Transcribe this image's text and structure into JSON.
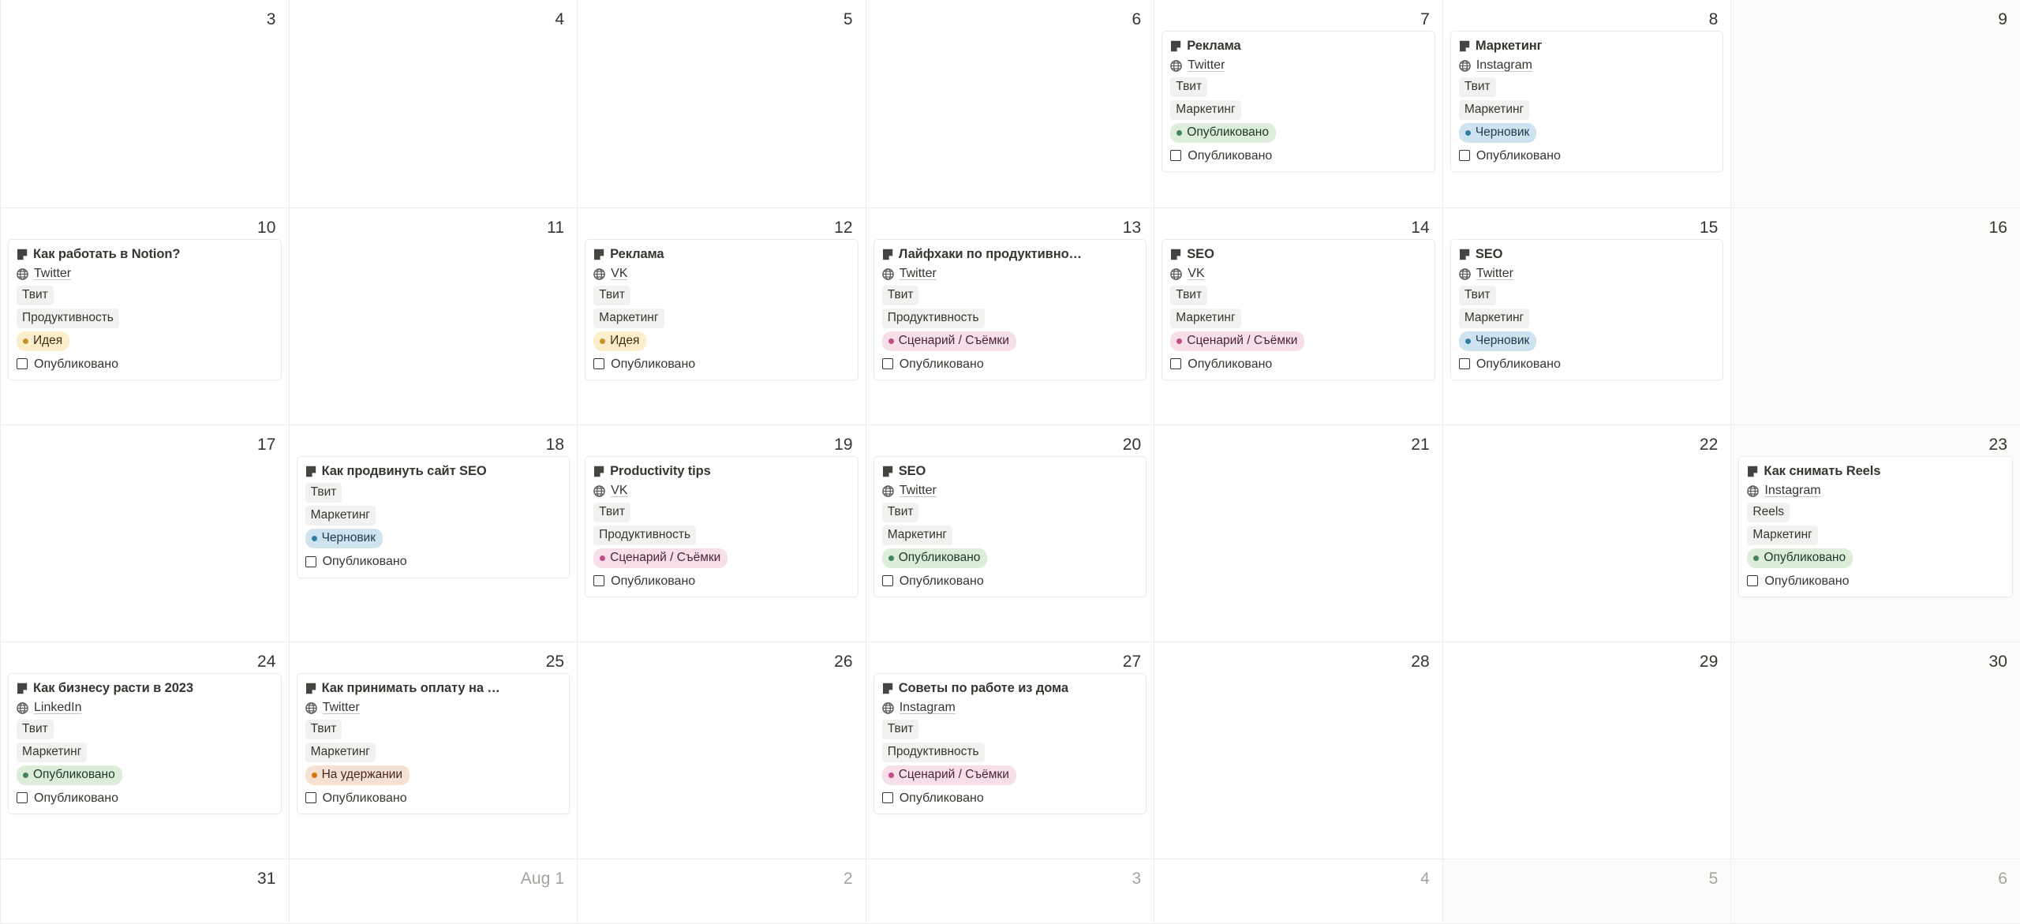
{
  "view": {
    "type": "calendar-month-grid",
    "columns": 7,
    "rows": 5
  },
  "status_styles": {
    "Опубликовано": {
      "bg": "#dcedda",
      "text": "#1c3829",
      "dot": "#448361"
    },
    "Черновик": {
      "bg": "#cfe3ef",
      "text": "#203b50",
      "dot": "#337ea9"
    },
    "Идея": {
      "bg": "#fbeeca",
      "text": "#402c1b",
      "dot": "#cb912f"
    },
    "Сценарий / Съёмки": {
      "bg": "#f7dfe9",
      "text": "#4c2337",
      "dot": "#c14c8a"
    },
    "На удержании": {
      "bg": "#f5e0d4",
      "text": "#49281e",
      "dot": "#d9730d"
    }
  },
  "cells": [
    {
      "date": "3",
      "other_month": false,
      "dim": false,
      "cards": []
    },
    {
      "date": "4",
      "other_month": false,
      "dim": false,
      "cards": []
    },
    {
      "date": "5",
      "other_month": false,
      "dim": false,
      "cards": []
    },
    {
      "date": "6",
      "other_month": false,
      "dim": false,
      "cards": []
    },
    {
      "date": "7",
      "other_month": false,
      "dim": false,
      "cards": [
        {
          "title": "Реклама",
          "url": "Twitter",
          "tags": [
            "Твит",
            "Маркетинг"
          ],
          "status": "Опубликовано",
          "check_label": "Опубликовано",
          "checked": false
        }
      ]
    },
    {
      "date": "8",
      "other_month": false,
      "dim": false,
      "cards": [
        {
          "title": "Маркетинг",
          "url": "Instagram",
          "tags": [
            "Твит",
            "Маркетинг"
          ],
          "status": "Черновик",
          "check_label": "Опубликовано",
          "checked": false
        }
      ]
    },
    {
      "date": "9",
      "other_month": false,
      "dim": true,
      "cards": []
    },
    {
      "date": "10",
      "other_month": false,
      "dim": false,
      "cards": [
        {
          "title": "Как работать в Notion?",
          "url": "Twitter",
          "tags": [
            "Твит",
            "Продуктивность"
          ],
          "status": "Идея",
          "check_label": "Опубликовано",
          "checked": false
        }
      ]
    },
    {
      "date": "11",
      "other_month": false,
      "dim": false,
      "cards": []
    },
    {
      "date": "12",
      "other_month": false,
      "dim": false,
      "cards": [
        {
          "title": "Реклама",
          "url": "VK",
          "tags": [
            "Твит",
            "Маркетинг"
          ],
          "status": "Идея",
          "check_label": "Опубликовано",
          "checked": false
        }
      ]
    },
    {
      "date": "13",
      "other_month": false,
      "dim": false,
      "cards": [
        {
          "title": "Лайфхаки по продуктивно…",
          "url": "Twitter",
          "tags": [
            "Твит",
            "Продуктивность"
          ],
          "status": "Сценарий / Съёмки",
          "check_label": "Опубликовано",
          "checked": false
        }
      ]
    },
    {
      "date": "14",
      "other_month": false,
      "dim": false,
      "cards": [
        {
          "title": "SEO",
          "url": "VK",
          "tags": [
            "Твит",
            "Маркетинг"
          ],
          "status": "Сценарий / Съёмки",
          "check_label": "Опубликовано",
          "checked": false
        }
      ]
    },
    {
      "date": "15",
      "other_month": false,
      "dim": false,
      "cards": [
        {
          "title": "SEO",
          "url": "Twitter",
          "tags": [
            "Твит",
            "Маркетинг"
          ],
          "status": "Черновик",
          "check_label": "Опубликовано",
          "checked": false
        }
      ]
    },
    {
      "date": "16",
      "other_month": false,
      "dim": true,
      "cards": []
    },
    {
      "date": "17",
      "other_month": false,
      "dim": false,
      "cards": []
    },
    {
      "date": "18",
      "other_month": false,
      "dim": false,
      "cards": [
        {
          "title": "Как продвинуть сайт SEO",
          "url": null,
          "tags": [
            "Твит",
            "Маркетинг"
          ],
          "status": "Черновик",
          "check_label": "Опубликовано",
          "checked": false
        }
      ]
    },
    {
      "date": "19",
      "other_month": false,
      "dim": false,
      "cards": [
        {
          "title": "Productivity tips",
          "url": "VK",
          "tags": [
            "Твит",
            "Продуктивность"
          ],
          "status": "Сценарий / Съёмки",
          "check_label": "Опубликовано",
          "checked": false
        }
      ]
    },
    {
      "date": "20",
      "other_month": false,
      "dim": false,
      "cards": [
        {
          "title": "SEO",
          "url": "Twitter",
          "tags": [
            "Твит",
            "Маркетинг"
          ],
          "status": "Опубликовано",
          "check_label": "Опубликовано",
          "checked": false
        }
      ]
    },
    {
      "date": "21",
      "other_month": false,
      "dim": false,
      "cards": []
    },
    {
      "date": "22",
      "other_month": false,
      "dim": false,
      "cards": []
    },
    {
      "date": "23",
      "other_month": false,
      "dim": true,
      "cards": [
        {
          "title": "Как снимать Reels",
          "url": "Instagram",
          "tags": [
            "Reels",
            "Маркетинг"
          ],
          "status": "Опубликовано",
          "check_label": "Опубликовано",
          "checked": false
        }
      ]
    },
    {
      "date": "24",
      "other_month": false,
      "dim": false,
      "cards": [
        {
          "title": "Как бизнесу расти в 2023",
          "url": "LinkedIn",
          "tags": [
            "Твит",
            "Маркетинг"
          ],
          "status": "Опубликовано",
          "check_label": "Опубликовано",
          "checked": false
        }
      ]
    },
    {
      "date": "25",
      "other_month": false,
      "dim": false,
      "cards": [
        {
          "title": "Как принимать оплату на …",
          "url": "Twitter",
          "tags": [
            "Твит",
            "Маркетинг"
          ],
          "status": "На удержании",
          "check_label": "Опубликовано",
          "checked": false
        }
      ]
    },
    {
      "date": "26",
      "other_month": false,
      "dim": false,
      "cards": []
    },
    {
      "date": "27",
      "other_month": false,
      "dim": false,
      "cards": [
        {
          "title": "Советы по работе из дома",
          "url": "Instagram",
          "tags": [
            "Твит",
            "Продуктивность"
          ],
          "status": "Сценарий / Съёмки",
          "check_label": "Опубликовано",
          "checked": false
        }
      ]
    },
    {
      "date": "28",
      "other_month": false,
      "dim": false,
      "cards": []
    },
    {
      "date": "29",
      "other_month": false,
      "dim": false,
      "cards": []
    },
    {
      "date": "30",
      "other_month": false,
      "dim": true,
      "cards": []
    },
    {
      "date": "31",
      "other_month": false,
      "dim": false,
      "cards": []
    },
    {
      "date": "Aug 1",
      "other_month": true,
      "dim": false,
      "cards": []
    },
    {
      "date": "2",
      "other_month": true,
      "dim": false,
      "cards": []
    },
    {
      "date": "3",
      "other_month": true,
      "dim": false,
      "cards": []
    },
    {
      "date": "4",
      "other_month": true,
      "dim": false,
      "cards": []
    },
    {
      "date": "5",
      "other_month": true,
      "dim": true,
      "cards": []
    },
    {
      "date": "6",
      "other_month": true,
      "dim": true,
      "cards": []
    }
  ]
}
